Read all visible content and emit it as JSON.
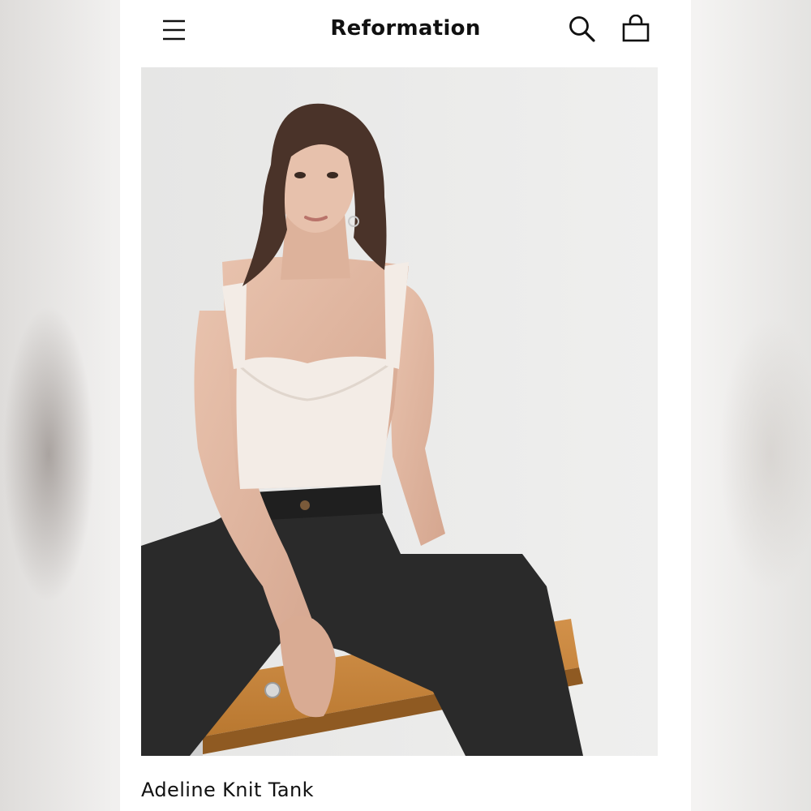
{
  "header": {
    "brand": "Reformation",
    "menu_icon": "hamburger-menu-icon",
    "search_icon": "search-icon",
    "bag_icon": "shopping-bag-icon"
  },
  "product": {
    "name": "Adeline Knit Tank",
    "image_description_icon": "product-photo"
  },
  "colors": {
    "background": "#ffffff",
    "text": "#111111",
    "photo_backdrop": "#ebebea"
  }
}
